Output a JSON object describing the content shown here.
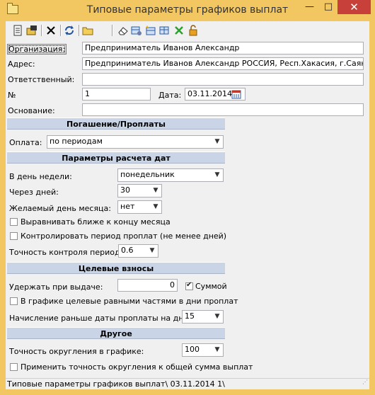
{
  "window": {
    "title": "Типовые параметры графиков выплат",
    "minimize": "—",
    "maximize": "□",
    "close": "✕"
  },
  "toolbar": {
    "icons": [
      "new-document-icon",
      "open-icon",
      "delete-icon",
      "refresh-icon",
      "folder-icon",
      "eraser-icon",
      "table-settings-icon",
      "table-add-icon",
      "table-edit-icon",
      "green-x-icon",
      "lock-icon"
    ]
  },
  "form": {
    "org_label": "Организация:",
    "org_value": "Предприниматель Иванов Александр",
    "address_label": "Адрес:",
    "address_value": "Предприниматель Иванов Александр РОССИЯ, Респ.Хакасия, г.Саяногорск",
    "responsible_label": "Ответственный:",
    "responsible_value": "",
    "number_label": "№",
    "number_value": "1",
    "date_label": "Дата:",
    "date_value": "03.11.2014",
    "basis_label": "Основание:",
    "basis_value": ""
  },
  "sections": {
    "repayment": "Погашение/Проплаты",
    "dates": "Параметры расчета дат",
    "target": "Целевые взносы",
    "other": "Другое"
  },
  "repayment": {
    "payment_label": "Оплата:",
    "payment_value": "по периодам"
  },
  "dates": {
    "weekday_label": "В день недели:",
    "weekday_value": "понедельник",
    "days_label": "Через дней:",
    "days_value": "30",
    "month_day_label": "Желаемый день месяца:",
    "month_day_value": "нет",
    "align_end_label": "Выравнивать ближе к концу месяца",
    "align_end_checked": false,
    "control_period_label": "Контролировать период проплат (не менее дней)",
    "control_period_checked": false,
    "accuracy_label": "Точность контроля периода:",
    "accuracy_value": "0.6"
  },
  "target": {
    "withhold_label": "Удержать при выдаче:",
    "withhold_value": "0",
    "sum_label": "Суммой",
    "sum_checked": true,
    "equal_parts_label": "В графике целевые равными частями в дни проплат",
    "equal_parts_checked": false,
    "accrual_label": "Начисление раньше даты проплаты на дней",
    "accrual_value": "15"
  },
  "other": {
    "rounding_label": "Точность округления в графике:",
    "rounding_value": "100",
    "apply_rounding_label": "Применить точность округления к общей сумма выплат",
    "apply_rounding_checked": false
  },
  "status_bar": "Типовые параметры графиков выплат\\ 03.11.2014 1\\"
}
